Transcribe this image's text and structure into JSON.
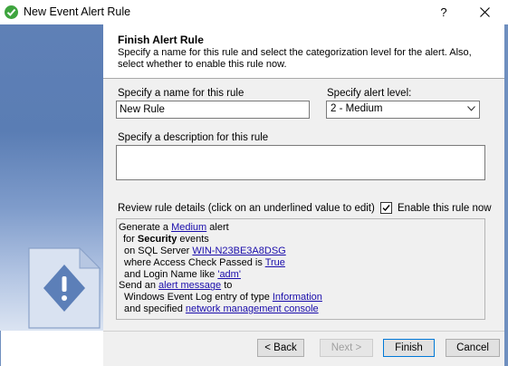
{
  "window": {
    "title": "New Event Alert Rule",
    "help_label": "?",
    "close_icon": "close-icon"
  },
  "header": {
    "title": "Finish Alert Rule",
    "description": "Specify a name for this rule and select the categorization level for the alert.  Also, select whether to enable this rule now."
  },
  "form": {
    "name_label": "Specify a name for this rule",
    "name_value": "New Rule",
    "level_label": "Specify alert level:",
    "level_value": "2 - Medium",
    "description_label": "Specify a description for this rule",
    "description_value": "",
    "review_label": "Review rule details (click on an underlined value to edit)",
    "enable_label": "Enable this rule now",
    "enable_checked": true
  },
  "details": {
    "l1": {
      "pre": "Generate a ",
      "link": "Medium",
      "post": " alert"
    },
    "l2": {
      "pre": "for ",
      "bold": "Security",
      "post": " events"
    },
    "l3": {
      "pre": "on SQL Server ",
      "link": "WIN-N23BE3A8DSG"
    },
    "l4": {
      "pre": "where Access Check Passed is ",
      "link": "True"
    },
    "l5": {
      "pre": "and Login Name like ",
      "link": "'adm'"
    },
    "l6": {
      "pre": "Send an ",
      "link": "alert message",
      "post": " to"
    },
    "l7": {
      "pre": "Windows Event Log entry of type ",
      "link": "Information"
    },
    "l8": {
      "pre": "and specified ",
      "link": "network management console"
    }
  },
  "buttons": {
    "back": "< Back",
    "next": "Next >",
    "finish": "Finish",
    "cancel": "Cancel"
  },
  "icons": {
    "app": "green-check-icon",
    "wizard": "alert-document-icon"
  },
  "colors": {
    "side_panel": "#5a7db4",
    "link": "#1a0dab",
    "app_icon": "#3ea43e"
  }
}
